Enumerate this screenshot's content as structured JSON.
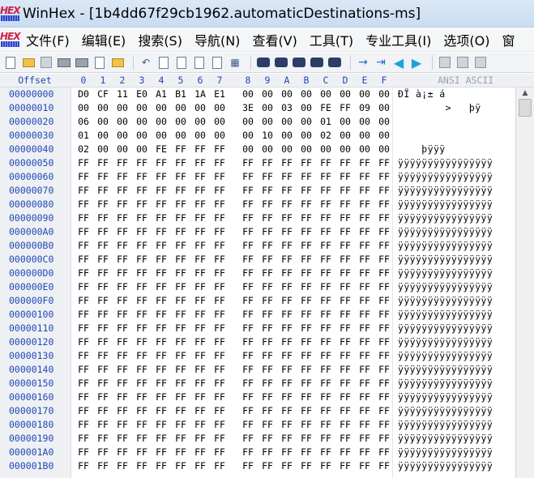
{
  "window": {
    "title": "WinHex - [1b4dd67f29cb1962.automaticDestinations-ms]",
    "logo_text": "HEX"
  },
  "menu": [
    "文件(F)",
    "编辑(E)",
    "搜索(S)",
    "导航(N)",
    "查看(V)",
    "工具(T)",
    "专业工具(I)",
    "选项(O)",
    "窗"
  ],
  "toolbar_icons": [
    "new-file-icon",
    "open-file-icon",
    "save-icon",
    "print-icon",
    "print-preview-icon",
    "properties-icon",
    "export-icon",
    "undo-icon",
    "copy-icon",
    "paste-icon",
    "paste-special-icon",
    "clipboard-icon",
    "binary-view-icon",
    "find-icon",
    "find-next-icon",
    "find-hex-icon",
    "replace-hex-icon",
    "find-hex-next-icon",
    "goto-offset-icon",
    "goto-position-icon",
    "back-icon",
    "forward-icon",
    "disk-icon",
    "ram-icon",
    "tool-icon"
  ],
  "header": {
    "offset_label": "Offset",
    "columns": [
      "0",
      "1",
      "2",
      "3",
      "4",
      "5",
      "6",
      "7",
      "8",
      "9",
      "A",
      "B",
      "C",
      "D",
      "E",
      "F"
    ],
    "ansi_label": "ANSI ASCII"
  },
  "rows": [
    {
      "offset": "00000000",
      "bytes": [
        "D0",
        "CF",
        "11",
        "E0",
        "A1",
        "B1",
        "1A",
        "E1",
        "00",
        "00",
        "00",
        "00",
        "00",
        "00",
        "00",
        "00"
      ],
      "ascii": "ÐÏ à¡± á"
    },
    {
      "offset": "00000010",
      "bytes": [
        "00",
        "00",
        "00",
        "00",
        "00",
        "00",
        "00",
        "00",
        "3E",
        "00",
        "03",
        "00",
        "FE",
        "FF",
        "09",
        "00"
      ],
      "ascii": "        >   þÿ"
    },
    {
      "offset": "00000020",
      "bytes": [
        "06",
        "00",
        "00",
        "00",
        "00",
        "00",
        "00",
        "00",
        "00",
        "00",
        "00",
        "00",
        "01",
        "00",
        "00",
        "00"
      ],
      "ascii": ""
    },
    {
      "offset": "00000030",
      "bytes": [
        "01",
        "00",
        "00",
        "00",
        "00",
        "00",
        "00",
        "00",
        "00",
        "10",
        "00",
        "00",
        "02",
        "00",
        "00",
        "00"
      ],
      "ascii": ""
    },
    {
      "offset": "00000040",
      "bytes": [
        "02",
        "00",
        "00",
        "00",
        "FE",
        "FF",
        "FF",
        "FF",
        "00",
        "00",
        "00",
        "00",
        "00",
        "00",
        "00",
        "00"
      ],
      "ascii": "    þÿÿÿ"
    },
    {
      "offset": "00000050",
      "bytes": [
        "FF",
        "FF",
        "FF",
        "FF",
        "FF",
        "FF",
        "FF",
        "FF",
        "FF",
        "FF",
        "FF",
        "FF",
        "FF",
        "FF",
        "FF",
        "FF"
      ],
      "ascii": "ÿÿÿÿÿÿÿÿÿÿÿÿÿÿÿÿ"
    },
    {
      "offset": "00000060",
      "bytes": [
        "FF",
        "FF",
        "FF",
        "FF",
        "FF",
        "FF",
        "FF",
        "FF",
        "FF",
        "FF",
        "FF",
        "FF",
        "FF",
        "FF",
        "FF",
        "FF"
      ],
      "ascii": "ÿÿÿÿÿÿÿÿÿÿÿÿÿÿÿÿ"
    },
    {
      "offset": "00000070",
      "bytes": [
        "FF",
        "FF",
        "FF",
        "FF",
        "FF",
        "FF",
        "FF",
        "FF",
        "FF",
        "FF",
        "FF",
        "FF",
        "FF",
        "FF",
        "FF",
        "FF"
      ],
      "ascii": "ÿÿÿÿÿÿÿÿÿÿÿÿÿÿÿÿ"
    },
    {
      "offset": "00000080",
      "bytes": [
        "FF",
        "FF",
        "FF",
        "FF",
        "FF",
        "FF",
        "FF",
        "FF",
        "FF",
        "FF",
        "FF",
        "FF",
        "FF",
        "FF",
        "FF",
        "FF"
      ],
      "ascii": "ÿÿÿÿÿÿÿÿÿÿÿÿÿÿÿÿ"
    },
    {
      "offset": "00000090",
      "bytes": [
        "FF",
        "FF",
        "FF",
        "FF",
        "FF",
        "FF",
        "FF",
        "FF",
        "FF",
        "FF",
        "FF",
        "FF",
        "FF",
        "FF",
        "FF",
        "FF"
      ],
      "ascii": "ÿÿÿÿÿÿÿÿÿÿÿÿÿÿÿÿ"
    },
    {
      "offset": "000000A0",
      "bytes": [
        "FF",
        "FF",
        "FF",
        "FF",
        "FF",
        "FF",
        "FF",
        "FF",
        "FF",
        "FF",
        "FF",
        "FF",
        "FF",
        "FF",
        "FF",
        "FF"
      ],
      "ascii": "ÿÿÿÿÿÿÿÿÿÿÿÿÿÿÿÿ"
    },
    {
      "offset": "000000B0",
      "bytes": [
        "FF",
        "FF",
        "FF",
        "FF",
        "FF",
        "FF",
        "FF",
        "FF",
        "FF",
        "FF",
        "FF",
        "FF",
        "FF",
        "FF",
        "FF",
        "FF"
      ],
      "ascii": "ÿÿÿÿÿÿÿÿÿÿÿÿÿÿÿÿ"
    },
    {
      "offset": "000000C0",
      "bytes": [
        "FF",
        "FF",
        "FF",
        "FF",
        "FF",
        "FF",
        "FF",
        "FF",
        "FF",
        "FF",
        "FF",
        "FF",
        "FF",
        "FF",
        "FF",
        "FF"
      ],
      "ascii": "ÿÿÿÿÿÿÿÿÿÿÿÿÿÿÿÿ"
    },
    {
      "offset": "000000D0",
      "bytes": [
        "FF",
        "FF",
        "FF",
        "FF",
        "FF",
        "FF",
        "FF",
        "FF",
        "FF",
        "FF",
        "FF",
        "FF",
        "FF",
        "FF",
        "FF",
        "FF"
      ],
      "ascii": "ÿÿÿÿÿÿÿÿÿÿÿÿÿÿÿÿ"
    },
    {
      "offset": "000000E0",
      "bytes": [
        "FF",
        "FF",
        "FF",
        "FF",
        "FF",
        "FF",
        "FF",
        "FF",
        "FF",
        "FF",
        "FF",
        "FF",
        "FF",
        "FF",
        "FF",
        "FF"
      ],
      "ascii": "ÿÿÿÿÿÿÿÿÿÿÿÿÿÿÿÿ"
    },
    {
      "offset": "000000F0",
      "bytes": [
        "FF",
        "FF",
        "FF",
        "FF",
        "FF",
        "FF",
        "FF",
        "FF",
        "FF",
        "FF",
        "FF",
        "FF",
        "FF",
        "FF",
        "FF",
        "FF"
      ],
      "ascii": "ÿÿÿÿÿÿÿÿÿÿÿÿÿÿÿÿ"
    },
    {
      "offset": "00000100",
      "bytes": [
        "FF",
        "FF",
        "FF",
        "FF",
        "FF",
        "FF",
        "FF",
        "FF",
        "FF",
        "FF",
        "FF",
        "FF",
        "FF",
        "FF",
        "FF",
        "FF"
      ],
      "ascii": "ÿÿÿÿÿÿÿÿÿÿÿÿÿÿÿÿ"
    },
    {
      "offset": "00000110",
      "bytes": [
        "FF",
        "FF",
        "FF",
        "FF",
        "FF",
        "FF",
        "FF",
        "FF",
        "FF",
        "FF",
        "FF",
        "FF",
        "FF",
        "FF",
        "FF",
        "FF"
      ],
      "ascii": "ÿÿÿÿÿÿÿÿÿÿÿÿÿÿÿÿ"
    },
    {
      "offset": "00000120",
      "bytes": [
        "FF",
        "FF",
        "FF",
        "FF",
        "FF",
        "FF",
        "FF",
        "FF",
        "FF",
        "FF",
        "FF",
        "FF",
        "FF",
        "FF",
        "FF",
        "FF"
      ],
      "ascii": "ÿÿÿÿÿÿÿÿÿÿÿÿÿÿÿÿ"
    },
    {
      "offset": "00000130",
      "bytes": [
        "FF",
        "FF",
        "FF",
        "FF",
        "FF",
        "FF",
        "FF",
        "FF",
        "FF",
        "FF",
        "FF",
        "FF",
        "FF",
        "FF",
        "FF",
        "FF"
      ],
      "ascii": "ÿÿÿÿÿÿÿÿÿÿÿÿÿÿÿÿ"
    },
    {
      "offset": "00000140",
      "bytes": [
        "FF",
        "FF",
        "FF",
        "FF",
        "FF",
        "FF",
        "FF",
        "FF",
        "FF",
        "FF",
        "FF",
        "FF",
        "FF",
        "FF",
        "FF",
        "FF"
      ],
      "ascii": "ÿÿÿÿÿÿÿÿÿÿÿÿÿÿÿÿ"
    },
    {
      "offset": "00000150",
      "bytes": [
        "FF",
        "FF",
        "FF",
        "FF",
        "FF",
        "FF",
        "FF",
        "FF",
        "FF",
        "FF",
        "FF",
        "FF",
        "FF",
        "FF",
        "FF",
        "FF"
      ],
      "ascii": "ÿÿÿÿÿÿÿÿÿÿÿÿÿÿÿÿ"
    },
    {
      "offset": "00000160",
      "bytes": [
        "FF",
        "FF",
        "FF",
        "FF",
        "FF",
        "FF",
        "FF",
        "FF",
        "FF",
        "FF",
        "FF",
        "FF",
        "FF",
        "FF",
        "FF",
        "FF"
      ],
      "ascii": "ÿÿÿÿÿÿÿÿÿÿÿÿÿÿÿÿ"
    },
    {
      "offset": "00000170",
      "bytes": [
        "FF",
        "FF",
        "FF",
        "FF",
        "FF",
        "FF",
        "FF",
        "FF",
        "FF",
        "FF",
        "FF",
        "FF",
        "FF",
        "FF",
        "FF",
        "FF"
      ],
      "ascii": "ÿÿÿÿÿÿÿÿÿÿÿÿÿÿÿÿ"
    },
    {
      "offset": "00000180",
      "bytes": [
        "FF",
        "FF",
        "FF",
        "FF",
        "FF",
        "FF",
        "FF",
        "FF",
        "FF",
        "FF",
        "FF",
        "FF",
        "FF",
        "FF",
        "FF",
        "FF"
      ],
      "ascii": "ÿÿÿÿÿÿÿÿÿÿÿÿÿÿÿÿ"
    },
    {
      "offset": "00000190",
      "bytes": [
        "FF",
        "FF",
        "FF",
        "FF",
        "FF",
        "FF",
        "FF",
        "FF",
        "FF",
        "FF",
        "FF",
        "FF",
        "FF",
        "FF",
        "FF",
        "FF"
      ],
      "ascii": "ÿÿÿÿÿÿÿÿÿÿÿÿÿÿÿÿ"
    },
    {
      "offset": "000001A0",
      "bytes": [
        "FF",
        "FF",
        "FF",
        "FF",
        "FF",
        "FF",
        "FF",
        "FF",
        "FF",
        "FF",
        "FF",
        "FF",
        "FF",
        "FF",
        "FF",
        "FF"
      ],
      "ascii": "ÿÿÿÿÿÿÿÿÿÿÿÿÿÿÿÿ"
    },
    {
      "offset": "000001B0",
      "bytes": [
        "FF",
        "FF",
        "FF",
        "FF",
        "FF",
        "FF",
        "FF",
        "FF",
        "FF",
        "FF",
        "FF",
        "FF",
        "FF",
        "FF",
        "FF",
        "FF"
      ],
      "ascii": "ÿÿÿÿÿÿÿÿÿÿÿÿÿÿÿÿ"
    }
  ]
}
